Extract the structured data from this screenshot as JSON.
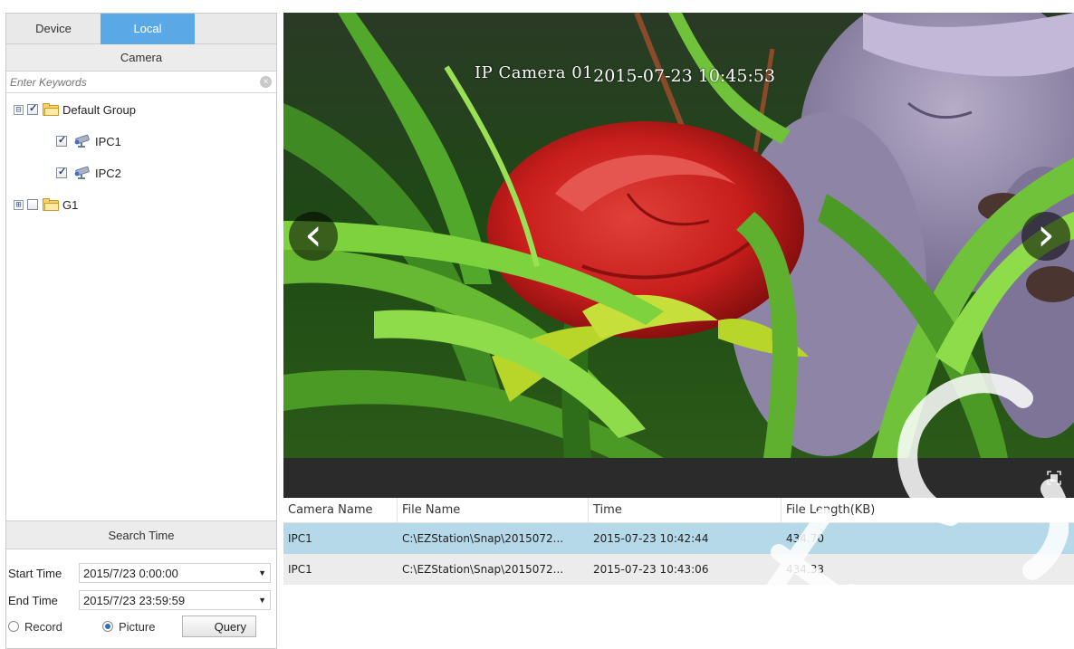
{
  "left_panel": {
    "tabs": [
      {
        "label": "Device",
        "active": false
      },
      {
        "label": "Local",
        "active": true
      }
    ],
    "camera_header": "Camera",
    "search_placeholder": "Enter Keywords",
    "tree": {
      "default_group": {
        "label": "Default Group",
        "checked": true,
        "expander": "⊟"
      },
      "ipc1": {
        "label": "IPC1",
        "checked": true
      },
      "ipc2": {
        "label": "IPC2",
        "checked": true
      },
      "g1": {
        "label": "G1",
        "checked": false,
        "expander": "⊞"
      }
    },
    "search_time": {
      "header": "Search Time",
      "start_label": "Start Time",
      "start_value": "2015/7/23 0:00:00",
      "end_label": "End Time",
      "end_value": "2015/7/23 23:59:59",
      "record_label": "Record",
      "picture_label": "Picture",
      "selected_type": "Picture",
      "query_label": "Query"
    }
  },
  "video": {
    "osd_camera": "IP Camera 01",
    "osd_timestamp": "2015-07-23 10:45:53",
    "prev_glyph": "‹",
    "next_glyph": "›"
  },
  "results": {
    "columns": [
      "Camera Name",
      "File Name",
      "Time",
      "File Length(KB)"
    ],
    "rows": [
      {
        "camera": "IPC1",
        "file": "C:\\EZStation\\Snap\\2015072...",
        "time": "2015-07-23 10:42:44",
        "length": "434.70",
        "selected": true
      },
      {
        "camera": "IPC1",
        "file": "C:\\EZStation\\Snap\\2015072...",
        "time": "2015-07-23 10:43:06",
        "length": "434.33",
        "selected": false
      }
    ]
  },
  "colors": {
    "tab_active": "#5aa9e6",
    "row_selected": "#b5d9e8",
    "row_alt": "#ececec",
    "control_bar": "#2b2b2b"
  }
}
